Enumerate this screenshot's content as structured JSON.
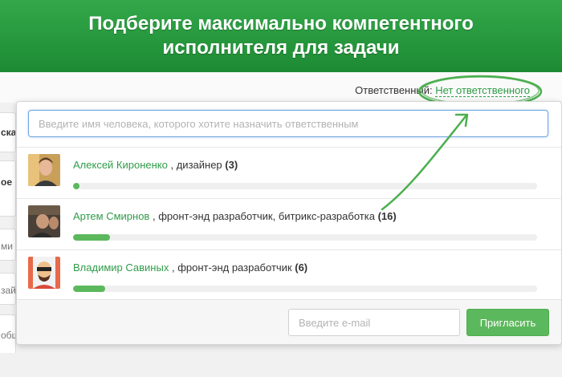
{
  "banner": {
    "title_line1": "Подберите максимально компетентного",
    "title_line2": "исполнителя для задачи"
  },
  "background_cards": [
    "ска",
    "ое",
    "ми",
    "зай",
    "общ"
  ],
  "responsible": {
    "label": "Ответственный:",
    "value": "Нет ответственного"
  },
  "dropdown": {
    "search_placeholder": "Введите имя человека, которого хотите назначить ответственным",
    "users": [
      {
        "name": "Алексей Кироненко",
        "role": ", дизайнер",
        "count": "(3)",
        "load": 0.01
      },
      {
        "name": "Артем Смирнов",
        "role": ", фронт-энд разработчик, битрикс-разработка",
        "count": "(16)",
        "load": 0.08
      },
      {
        "name": "Владимир Савиных",
        "role": ", фронт-энд разработчик",
        "count": "(6)",
        "load": 0.07
      }
    ],
    "email_placeholder": "Введите e-mail",
    "invite_label": "Пригласить"
  },
  "colors": {
    "accent": "#2f9c48",
    "banner": "#23923a",
    "button": "#5cb85c"
  }
}
